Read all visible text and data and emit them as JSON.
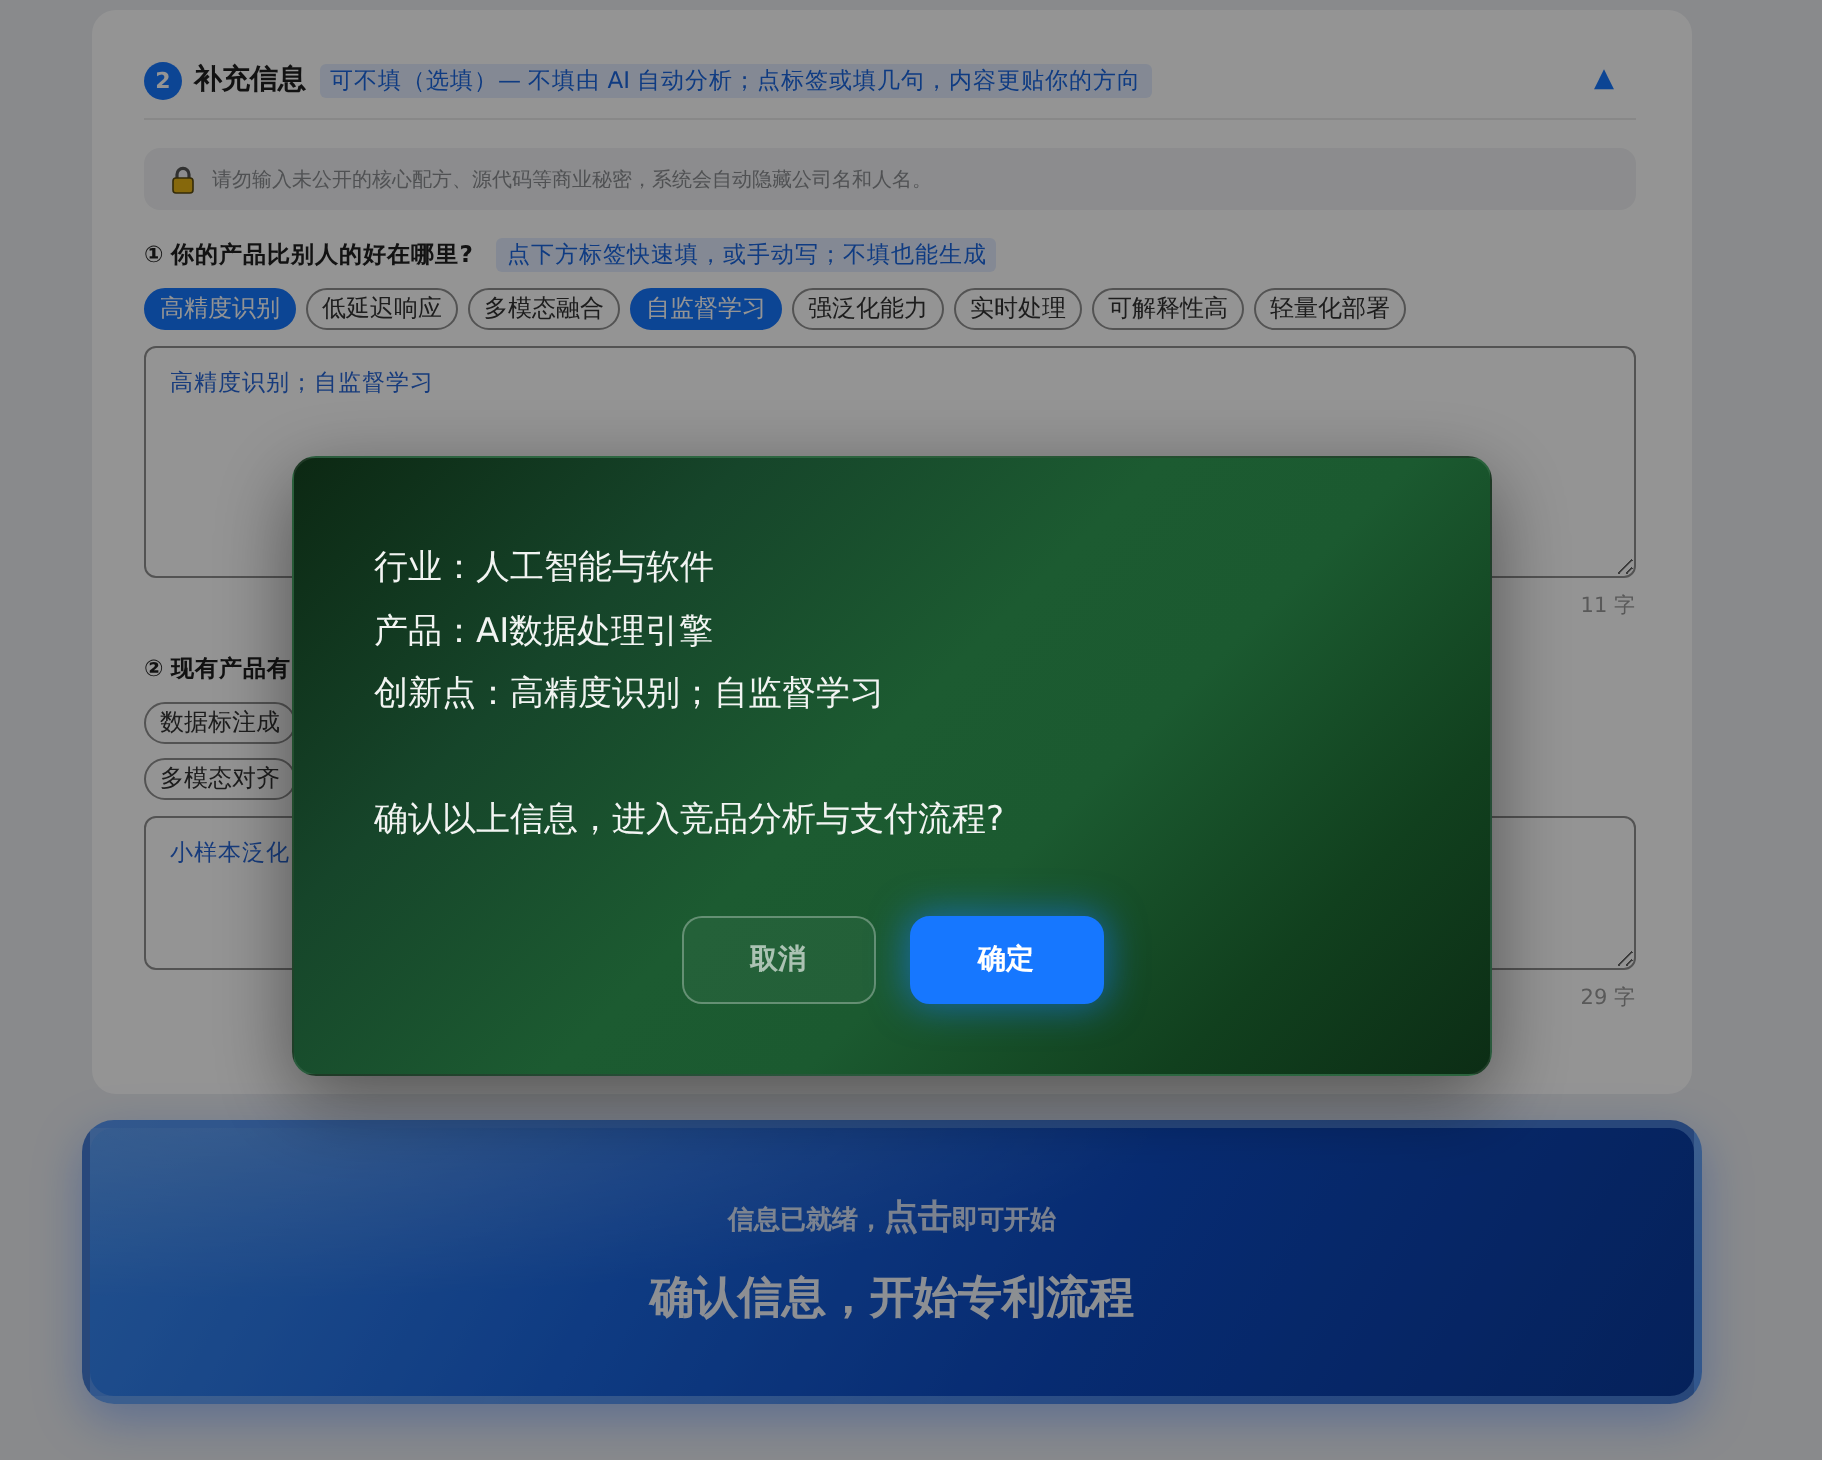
{
  "section": {
    "step": "2",
    "title": "补充信息",
    "hint": "可不填（选填）— 不填由 AI 自动分析；点标签或填几句，内容更贴你的方向",
    "toggle": "▲"
  },
  "notice": {
    "text": "请勿输入未公开的核心配方、源代码等商业秘密，系统会自动隐藏公司名和人名。"
  },
  "questions": [
    {
      "title": "① 你的产品比别人的好在哪里?",
      "hint": "点下方标签快速填，或手动写；不填也能生成",
      "tag_rows": [
        [
          {
            "label": "高精度识别",
            "selected": true
          },
          {
            "label": "低延迟响应",
            "selected": false
          },
          {
            "label": "多模态融合",
            "selected": false
          },
          {
            "label": "自监督学习",
            "selected": true
          },
          {
            "label": "强泛化能力",
            "selected": false
          },
          {
            "label": "实时处理",
            "selected": false
          },
          {
            "label": "可解释性高",
            "selected": false
          },
          {
            "label": "轻量化部署",
            "selected": false
          }
        ]
      ],
      "answer": "高精度识别；自监督学习",
      "count": "11 字"
    },
    {
      "title": "② 现有产品有",
      "tag_rows": [
        [
          {
            "label": "数据标注成",
            "selected": false
          }
        ],
        [
          {
            "label": "多模态对齐",
            "selected": false
          }
        ]
      ],
      "answer": "小样本泛化",
      "count": "29 字"
    }
  ],
  "dialog": {
    "lines": [
      "行业：人工智能与软件",
      "产品：AI数据处理引擎",
      "创新点：高精度识别；自监督学习"
    ],
    "question": "确认以上信息，进入竞品分析与支付流程?",
    "buttons": [
      {
        "label": "取消",
        "kind": "secondary"
      },
      {
        "label": "确定",
        "kind": "primary"
      }
    ]
  },
  "start_button": {
    "hint": "信息已就绪，**点击**即可开始",
    "label": "确认信息，开始专利流程"
  }
}
